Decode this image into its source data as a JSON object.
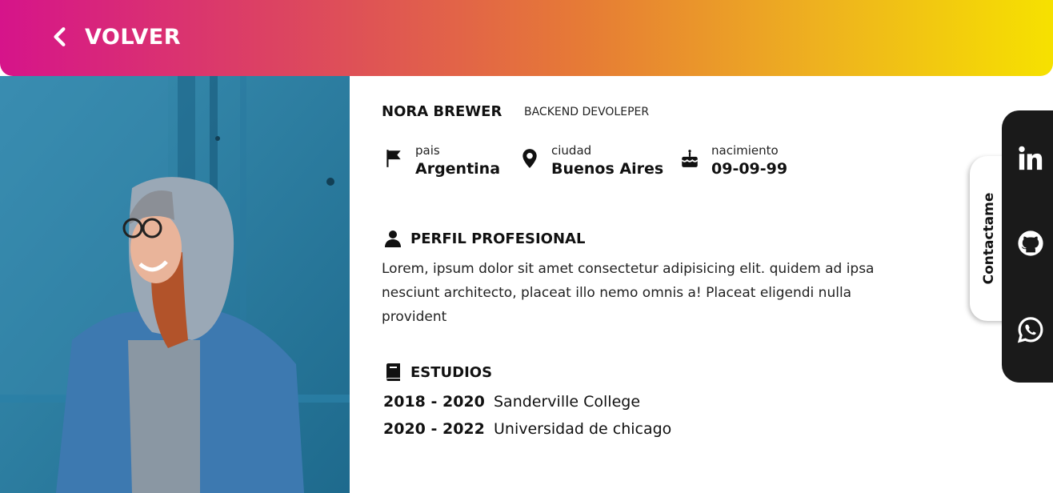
{
  "header": {
    "back_label": "VOLVER",
    "gradient": [
      "#d6148a",
      "#f6e100"
    ]
  },
  "profile": {
    "name": "NORA BREWER",
    "role": "BACKEND DEVOLEPER"
  },
  "info": [
    {
      "icon": "flag-icon",
      "label": "pais",
      "value": "Argentina"
    },
    {
      "icon": "location-pin-icon",
      "label": "ciudad",
      "value": "Buenos Aires"
    },
    {
      "icon": "birthday-cake-icon",
      "label": "nacimiento",
      "value": "09-09-99"
    }
  ],
  "perfil": {
    "title": "PERFIL PROFESIONAL",
    "text": "Lorem, ipsum dolor sit amet consectetur adipisicing elit. quidem ad ipsa nesciunt architecto, placeat illo nemo omnis a! Placeat eligendi nulla provident"
  },
  "estudios": {
    "title": "ESTUDIOS",
    "items": [
      {
        "years": "2018 - 2020",
        "institution": "Sanderville College"
      },
      {
        "years": "2020 - 2022",
        "institution": "Universidad de chicago"
      }
    ]
  },
  "contact": {
    "tab_label": "Contactame",
    "links": [
      "linkedin-icon",
      "github-icon",
      "whatsapp-icon"
    ]
  }
}
